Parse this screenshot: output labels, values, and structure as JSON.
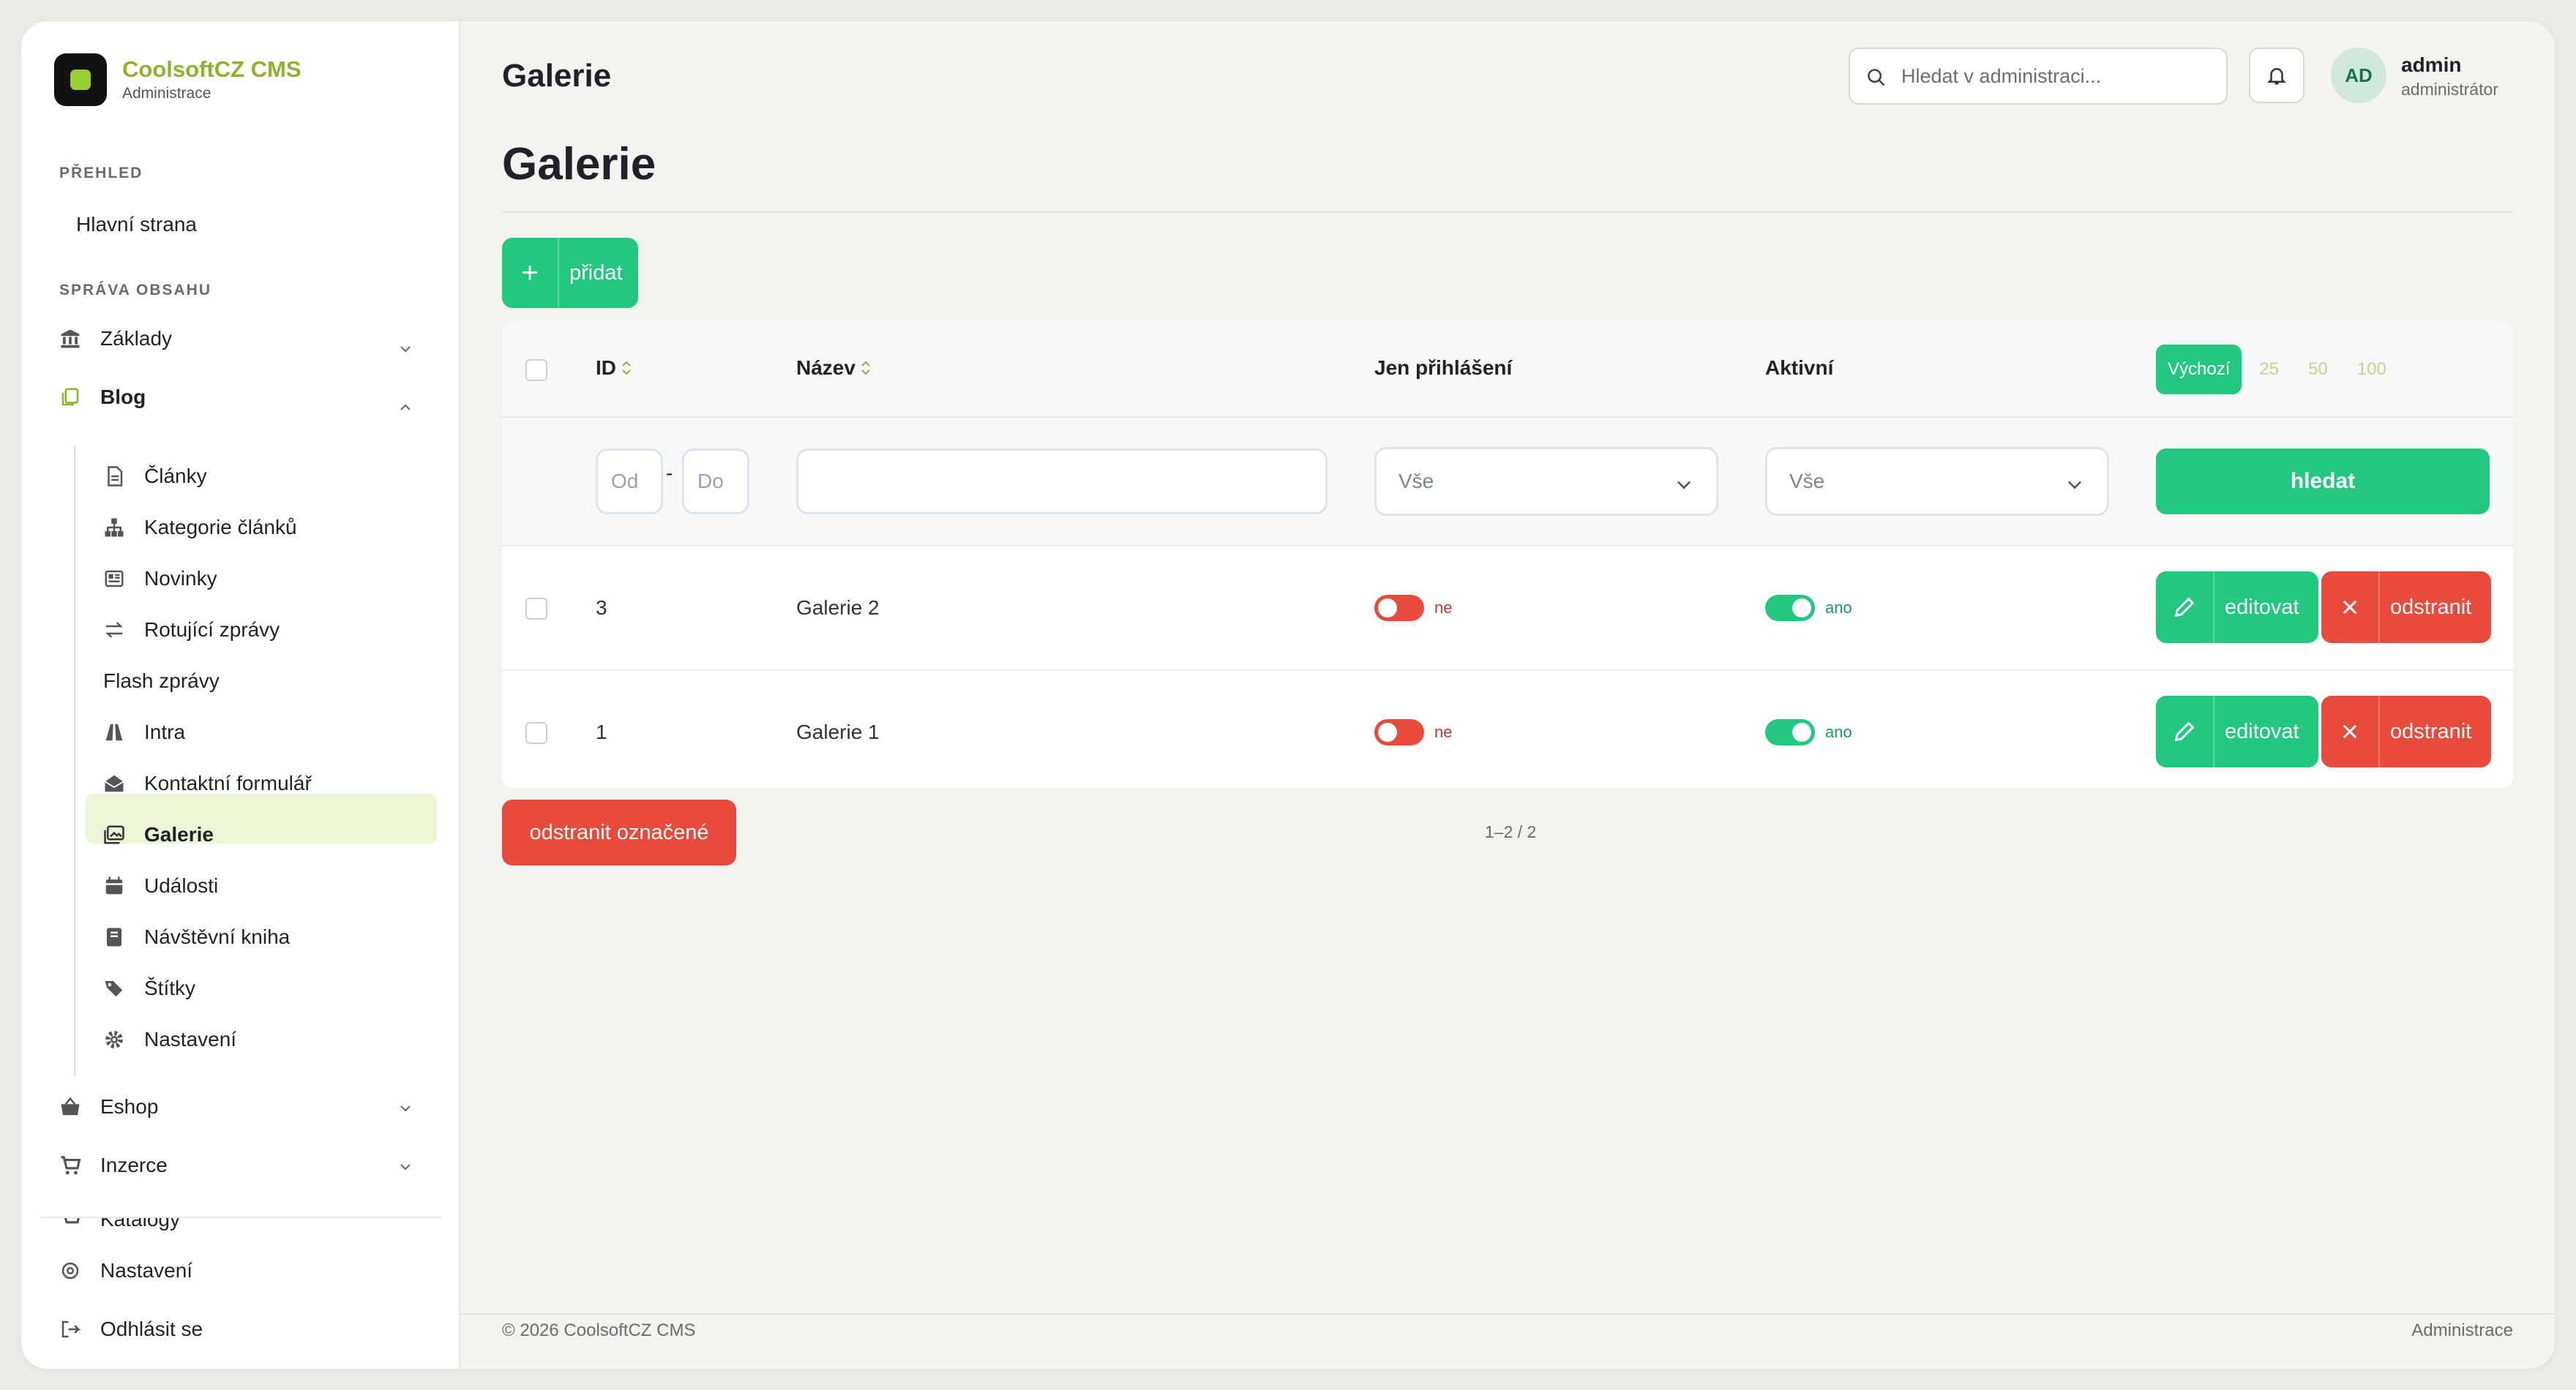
{
  "brand": {
    "name": "CoolsoftCZ CMS",
    "subtitle": "Administrace"
  },
  "sidebar": {
    "sections": [
      {
        "label": "PŘEHLED"
      },
      {
        "label": "SPRÁVA OBSAHU"
      }
    ],
    "home": "Hlavní strana",
    "groups": {
      "zaklady": "Základy",
      "blog": "Blog",
      "eshop": "Eshop",
      "inzerce": "Inzerce",
      "katalog": "Katalogy"
    },
    "blog_items": [
      {
        "label": "Články",
        "icon": "document-icon"
      },
      {
        "label": "Kategorie článků",
        "icon": "sitemap-icon"
      },
      {
        "label": "Novinky",
        "icon": "newspaper-icon"
      },
      {
        "label": "Rotující zprávy",
        "icon": "arrows-exchange-icon"
      },
      {
        "label": "Flash zprávy",
        "icon": ""
      },
      {
        "label": "Intra",
        "icon": "road-icon"
      },
      {
        "label": "Kontaktní formulář",
        "icon": "envelope-open-icon"
      },
      {
        "label": "Galerie",
        "icon": "images-icon"
      },
      {
        "label": "Události",
        "icon": "calendar-icon"
      },
      {
        "label": "Návštěvní kniha",
        "icon": "book-icon"
      },
      {
        "label": "Štítky",
        "icon": "tags-icon"
      },
      {
        "label": "Nastavení",
        "icon": "cog-icon"
      }
    ],
    "bottom": {
      "settings": "Nastavení",
      "logout": "Odhlásit se"
    }
  },
  "header": {
    "title": "Galerie",
    "search_placeholder": "Hledat v administraci...",
    "user": {
      "initials": "AD",
      "name": "admin",
      "role": "administrátor"
    }
  },
  "page": {
    "title": "Galerie",
    "add_button": "přidat",
    "columns": {
      "id": "ID",
      "name": "Název",
      "login_only": "Jen přihlášení",
      "active": "Aktivní"
    },
    "per_page": {
      "options": [
        "Výchozí",
        "25",
        "50",
        "100"
      ],
      "selected": "Výchozí"
    },
    "filters": {
      "id_from_placeholder": "Od",
      "id_to_placeholder": "Do",
      "name_value": "",
      "login_only": "Vše",
      "active": "Vše",
      "search_button": "hledat"
    },
    "rows": [
      {
        "id": "3",
        "name": "Galerie 2",
        "login_only": false,
        "login_only_label": "ne",
        "active": true,
        "active_label": "ano"
      },
      {
        "id": "1",
        "name": "Galerie 1",
        "login_only": false,
        "login_only_label": "ne",
        "active": true,
        "active_label": "ano"
      }
    ],
    "edit_label": "editovat",
    "delete_label": "odstranit",
    "delete_selected": "odstranit označené",
    "pagination": "1–2 / 2"
  },
  "footer": {
    "left": "© 2026 CoolsoftCZ CMS",
    "right": "Administrace"
  },
  "colors": {
    "accent": "#22c87f",
    "danger": "#e84a3c",
    "brand": "#8bb62b",
    "active_nav_bg": "#ecf5d6"
  }
}
